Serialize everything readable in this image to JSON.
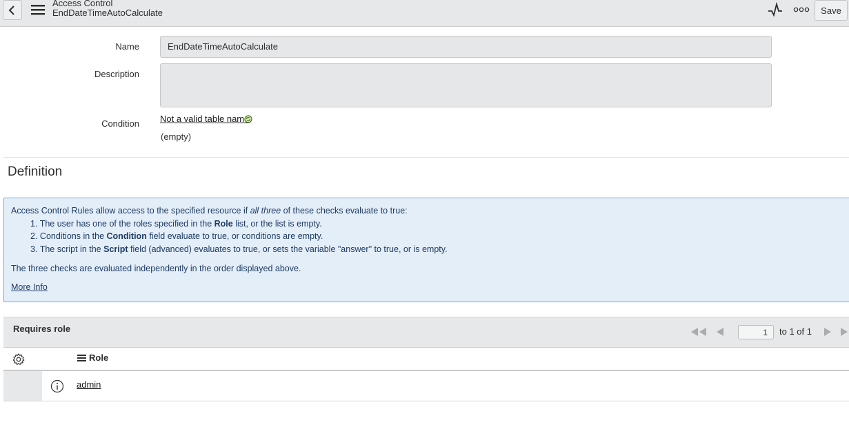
{
  "header": {
    "title": "Access Control",
    "subtitle": "EndDateTimeAutoCalculate",
    "save_label": "Save"
  },
  "form": {
    "name_label": "Name",
    "name_value": "EndDateTimeAutoCalculate",
    "description_label": "Description",
    "description_value": "",
    "condition_label": "Condition",
    "condition_link": "Not a valid table name",
    "condition_empty": "(empty)"
  },
  "definition": {
    "title": "Definition",
    "intro_prefix": "Access Control Rules allow access to the specified resource if ",
    "intro_em": "all three",
    "intro_suffix": " of these checks evaluate to true:",
    "items": [
      {
        "num": "1.",
        "pre": "The user has one of the roles specified in the ",
        "bold": "Role",
        "post": " list, or the list is empty."
      },
      {
        "num": "2.",
        "pre": "Conditions in the ",
        "bold": "Condition",
        "post": " field evaluate to true, or conditions are empty."
      },
      {
        "num": "3.",
        "pre": "The script in the ",
        "bold": "Script",
        "post": " field (advanced) evaluates to true, or sets the variable \"answer\" to true, or is empty."
      }
    ],
    "note": "The three checks are evaluated independently in the order displayed above.",
    "more_info": "More Info"
  },
  "related_list": {
    "title": "Requires role",
    "page_value": "1",
    "page_of": "to 1 of 1",
    "column_role": "Role",
    "rows": [
      {
        "role": "admin"
      }
    ]
  },
  "icons": [
    "back-icon",
    "hamburger-menu-icon",
    "activity-icon",
    "more-icon",
    "condition-refresh-icon",
    "first-page-icon",
    "prev-page-icon",
    "next-page-icon",
    "last-page-icon",
    "gear-icon",
    "column-menu-icon",
    "info-icon"
  ],
  "colors": {
    "info_background": "#e4eef8",
    "info_border": "#7aa6cf",
    "info_text": "#1d3b66",
    "header_background": "#e6e8ea"
  }
}
